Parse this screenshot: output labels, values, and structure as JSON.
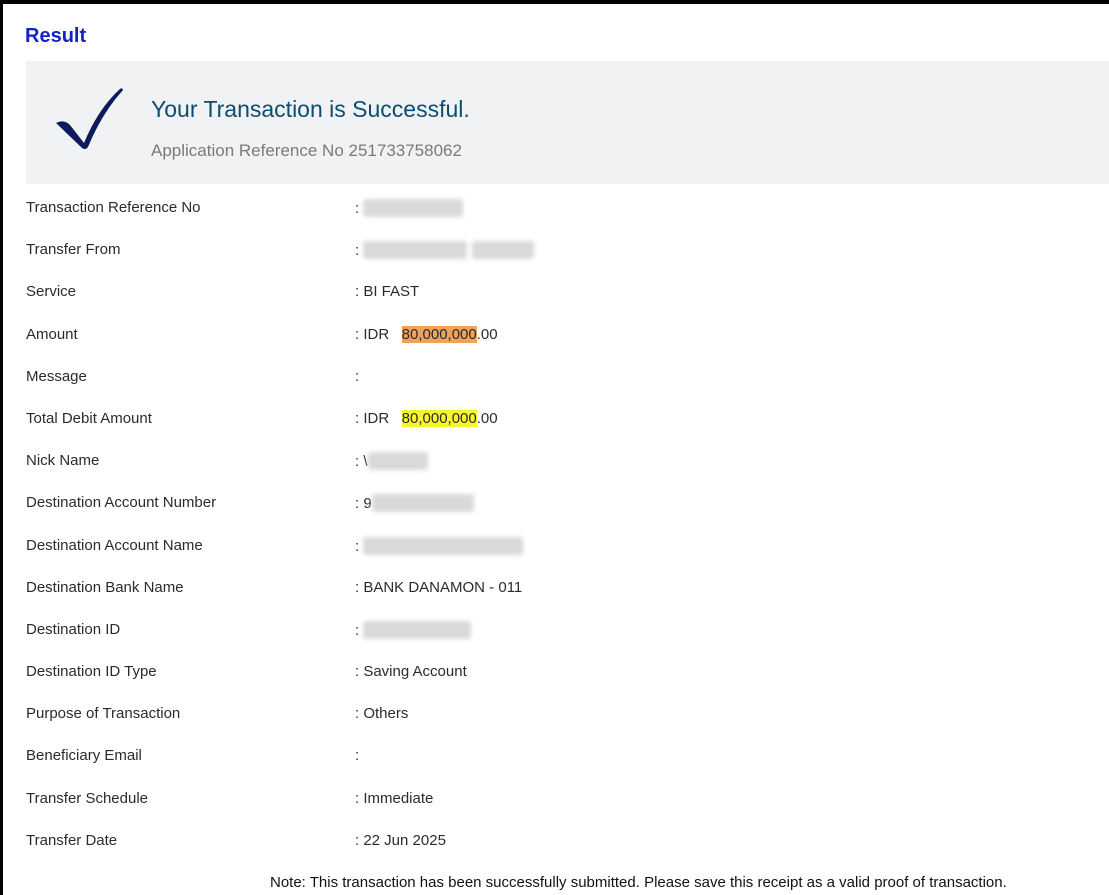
{
  "header": {
    "title": "Result"
  },
  "success": {
    "title": "Your Transaction is Successful.",
    "app_ref": "Application Reference No 251733758062",
    "icon": "checkmark-icon"
  },
  "rows": [
    {
      "label": "Transaction Reference No",
      "value": ":"
    },
    {
      "label": "Transfer From",
      "value": ":"
    },
    {
      "label": "Service",
      "value": ": BI FAST"
    },
    {
      "label": "Amount",
      "value_prefix": ": IDR   ",
      "value_highlight": "80,000,000",
      "value_suffix": ".00",
      "highlight_color": "#f0a15a"
    },
    {
      "label": "Message",
      "value": ":"
    },
    {
      "label": "Total Debit Amount",
      "value_prefix": ": IDR   ",
      "value_highlight": "80,000,000",
      "value_suffix": ".00",
      "highlight_color": "#f7f52d"
    },
    {
      "label": "Nick Name",
      "value": ": \\"
    },
    {
      "label": "Destination Account Number",
      "value": ": 9"
    },
    {
      "label": "Destination Account Name",
      "value": ":"
    },
    {
      "label": "Destination Bank Name",
      "value": ": BANK DANAMON - 011"
    },
    {
      "label": "Destination ID",
      "value": ":"
    },
    {
      "label": "Destination ID Type",
      "value": ": Saving Account"
    },
    {
      "label": "Purpose of Transaction",
      "value": ": Others"
    },
    {
      "label": "Beneficiary Email",
      "value": ":"
    },
    {
      "label": "Transfer Schedule",
      "value": ": Immediate"
    },
    {
      "label": "Transfer Date",
      "value": ": 22 Jun 2025"
    }
  ],
  "note": "Note: This transaction has been successfully submitted. Please save this receipt as a valid proof of transaction.",
  "colors": {
    "title_blue": "#1522c9",
    "success_teal": "#0b4d72",
    "check_navy": "#0d1a5e"
  }
}
